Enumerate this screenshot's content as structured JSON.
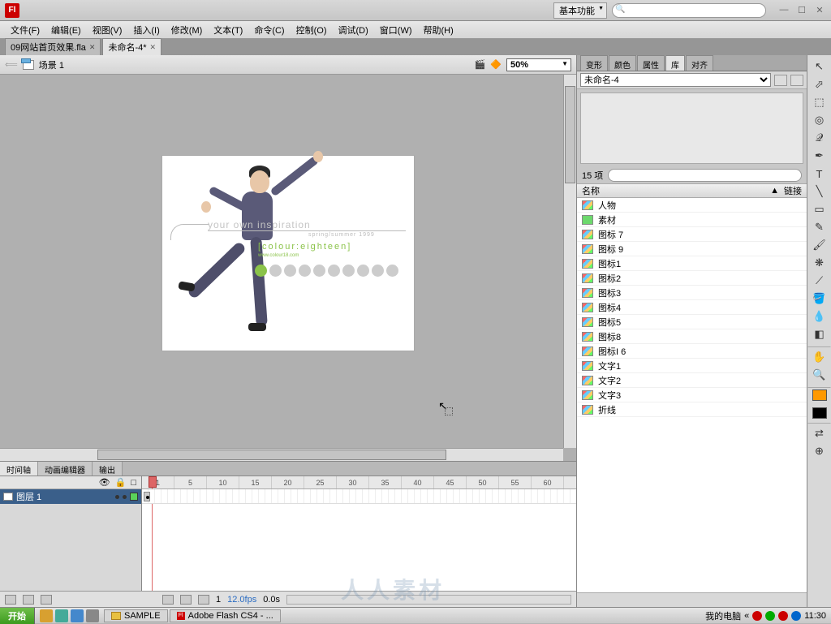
{
  "titlebar": {
    "workspace": "基本功能"
  },
  "menu": [
    "文件(F)",
    "编辑(E)",
    "视图(V)",
    "插入(I)",
    "修改(M)",
    "文本(T)",
    "命令(C)",
    "控制(O)",
    "调试(D)",
    "窗口(W)",
    "帮助(H)"
  ],
  "doctabs": [
    {
      "label": "09网站首页效果.fla",
      "active": false
    },
    {
      "label": "未命名-4*",
      "active": true
    }
  ],
  "scene": {
    "label": "场景 1",
    "zoom": "50%"
  },
  "canvas": {
    "text1": "your own inspiration",
    "text2": "spring/summer 1999",
    "text3": "[colour:eighteen]",
    "text4": "www.colour18.com"
  },
  "timeline": {
    "tabs": [
      "时间轴",
      "动画编辑器",
      "输出"
    ],
    "layer": "图层 1",
    "ruler": [
      "1",
      "5",
      "10",
      "15",
      "20",
      "25",
      "30",
      "35",
      "40",
      "45",
      "50",
      "55",
      "60"
    ],
    "frame": "1",
    "fps": "12.0fps",
    "time": "0.0s"
  },
  "panels": {
    "tabs": [
      "变形",
      "颜色",
      "属性",
      "库",
      "对齐"
    ],
    "doc": "未命名-4",
    "count": "15 项",
    "headers": {
      "name": "名称",
      "link": "链接"
    },
    "items": [
      "人物",
      "素材",
      "图标 7",
      "图标 9",
      "图标1",
      "图标2",
      "图标3",
      "图标4",
      "图标5",
      "图标8",
      "图标I 6",
      "文字1",
      "文字2",
      "文字3",
      "折线"
    ]
  },
  "taskbar": {
    "start": "开始",
    "buttons": [
      "SAMPLE",
      "Adobe Flash CS4 - ..."
    ],
    "computer": "我的电脑",
    "clock": "11:30"
  },
  "watermark": "人人素材"
}
